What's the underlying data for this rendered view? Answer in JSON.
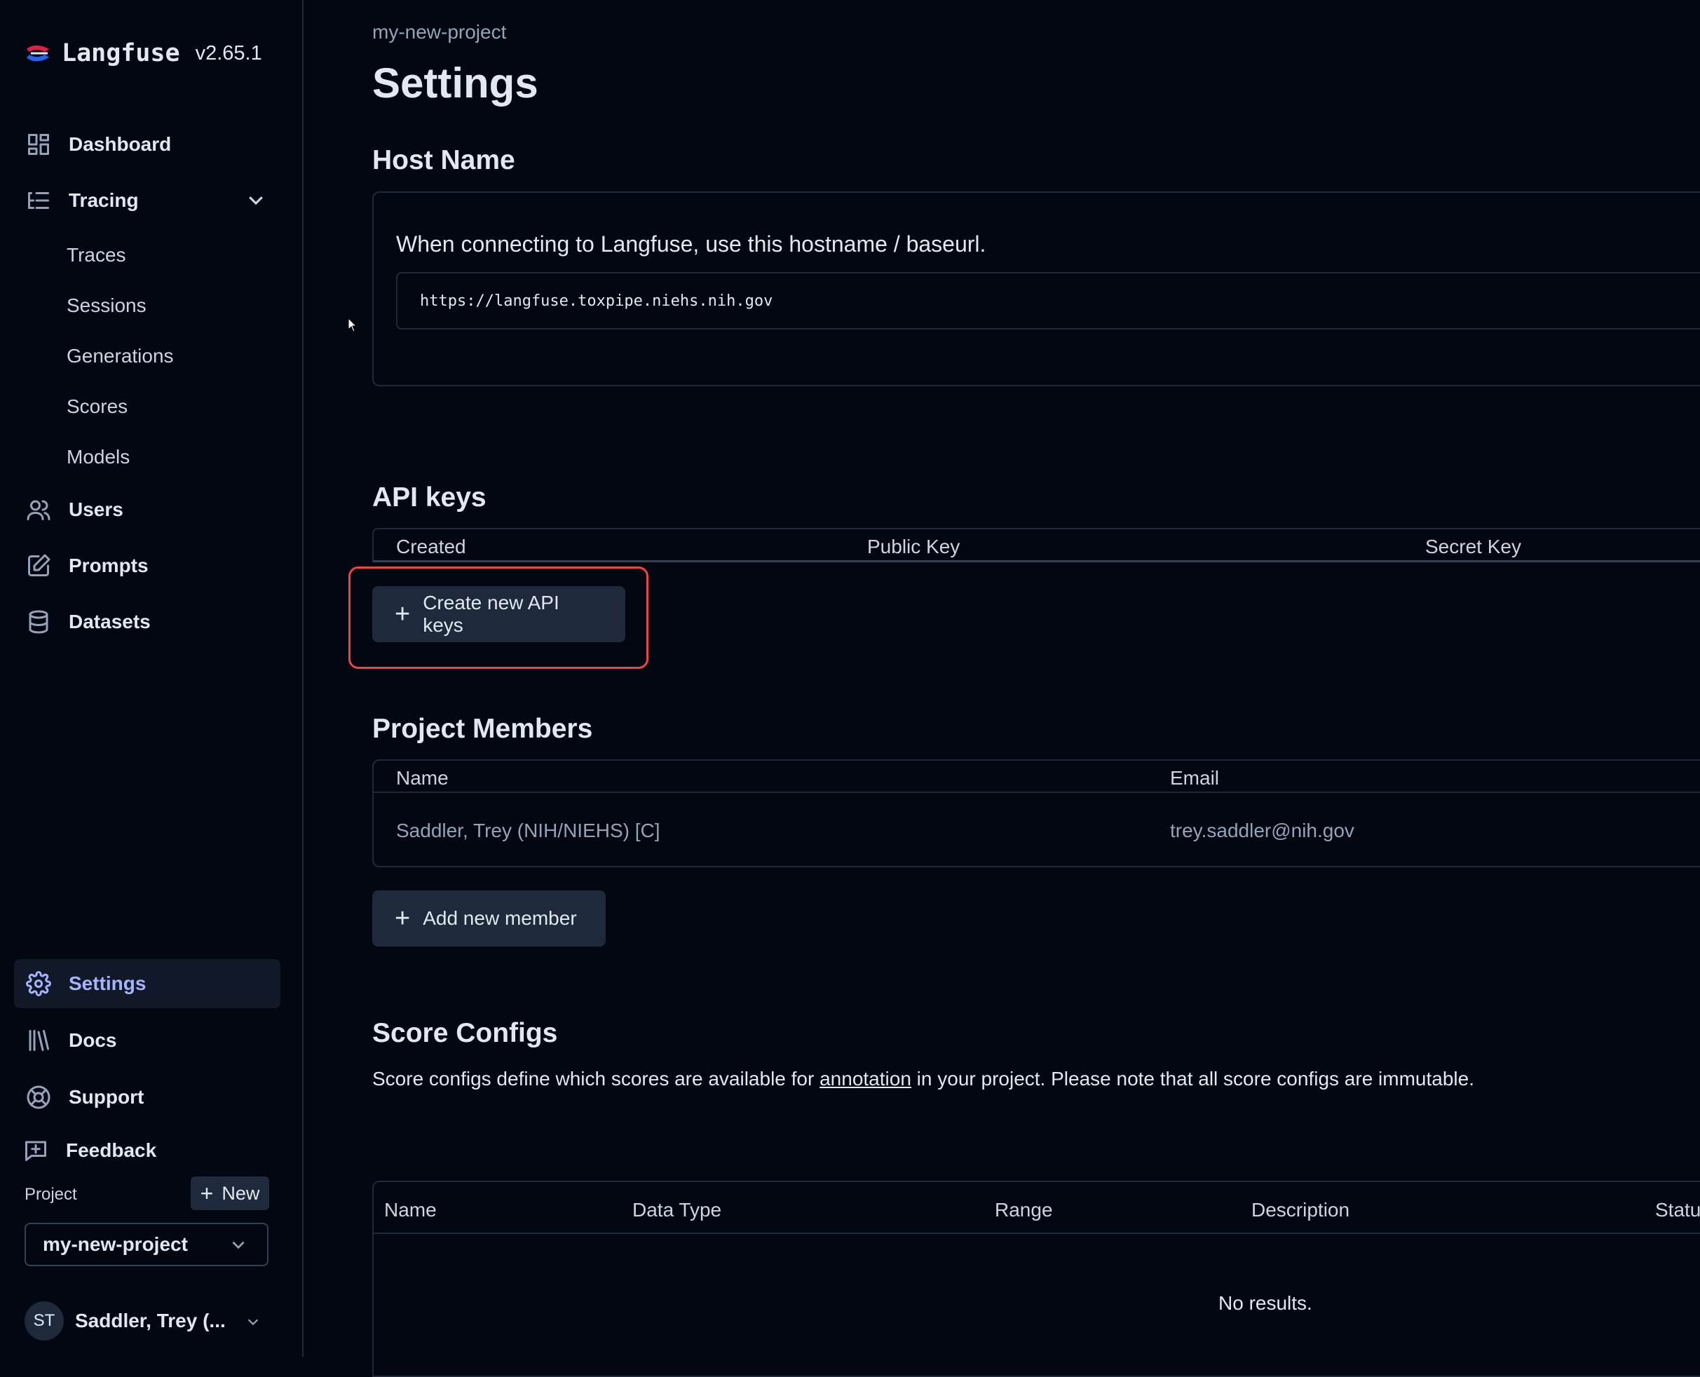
{
  "app": {
    "name": "Langfuse",
    "version": "v2.65.1"
  },
  "sidebar": {
    "items": [
      {
        "label": "Dashboard",
        "icon": "grid-icon"
      },
      {
        "label": "Tracing",
        "icon": "list-tree-icon"
      },
      {
        "label": "Users",
        "icon": "users-icon"
      },
      {
        "label": "Prompts",
        "icon": "pencil-square-icon"
      },
      {
        "label": "Datasets",
        "icon": "database-icon"
      }
    ],
    "tracing_sub": [
      "Traces",
      "Sessions",
      "Generations",
      "Scores",
      "Models"
    ],
    "bottom_items": [
      {
        "label": "Settings",
        "icon": "gear-icon",
        "active": true
      },
      {
        "label": "Docs",
        "icon": "library-icon"
      },
      {
        "label": "Support",
        "icon": "lifebuoy-icon"
      },
      {
        "label": "Feedback",
        "icon": "message-plus-icon"
      }
    ],
    "project_label": "Project",
    "new_label": "New",
    "project_selected": "my-new-project",
    "user_initials": "ST",
    "user_name": "Saddler, Trey (..."
  },
  "main": {
    "breadcrumb": "my-new-project",
    "title": "Settings",
    "host": {
      "heading": "Host Name",
      "description": "When connecting to Langfuse, use this hostname / baseurl.",
      "url": "https://langfuse.toxpipe.niehs.nih.gov"
    },
    "api_keys": {
      "heading": "API keys",
      "columns": [
        "Created",
        "Public Key",
        "Secret Key"
      ],
      "create_label": "Create new API keys"
    },
    "members": {
      "heading": "Project Members",
      "columns": [
        "Name",
        "Email"
      ],
      "rows": [
        {
          "name": "Saddler, Trey (NIH/NIEHS) [C]",
          "email": "trey.saddler@nih.gov"
        }
      ],
      "add_label": "Add new member"
    },
    "score_configs": {
      "heading": "Score Configs",
      "desc_before": "Score configs define which scores are available for ",
      "desc_link": "annotation",
      "desc_after": " in your project. Please note that all score configs are immutable.",
      "columns": [
        "Name",
        "Data Type",
        "Range",
        "Description",
        "Statu"
      ],
      "empty": "No results."
    }
  },
  "colors": {
    "background": "#030712",
    "accent": "#a5b4fc",
    "highlight": "#ef4444",
    "logo_red": "#e11d48",
    "logo_blue": "#2563eb"
  }
}
